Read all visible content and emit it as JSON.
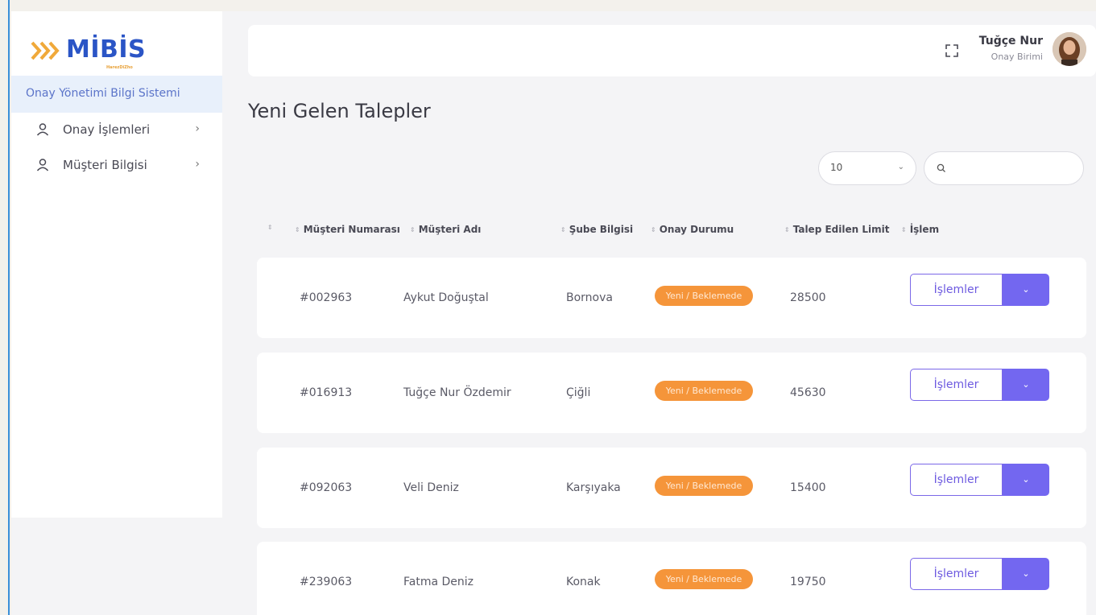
{
  "app": {
    "logo_text": "MİBİS",
    "logo_sub": "HarezDiZho",
    "system_title": "Onay Yönetimi Bilgi Sistemi"
  },
  "sidebar": {
    "items": [
      {
        "label": "Onay İşlemleri",
        "icon": "user-icon"
      },
      {
        "label": "Müşteri Bilgisi",
        "icon": "user-icon"
      }
    ]
  },
  "header": {
    "user_name": "Tuğçe Nur",
    "user_role": "Onay Birimi"
  },
  "page": {
    "title": "Yeni Gelen Talepler"
  },
  "controls": {
    "page_size": "10",
    "search_placeholder": ""
  },
  "table": {
    "columns": [
      "Müşteri Numarası",
      "Müşteri Adı",
      "Şube Bilgisi",
      "Onay Durumu",
      "Talep Edilen Limit",
      "İşlem"
    ],
    "rows": [
      {
        "number": "#002963",
        "name": "Aykut Doğuştal",
        "branch": "Bornova",
        "status": "Yeni / Beklemede",
        "limit": "28500",
        "action": "İşlemler"
      },
      {
        "number": "#016913",
        "name": "Tuğçe Nur Özdemir",
        "branch": "Çiğli",
        "status": "Yeni / Beklemede",
        "limit": "45630",
        "action": "İşlemler"
      },
      {
        "number": "#092063",
        "name": "Veli Deniz",
        "branch": "Karşıyaka",
        "status": "Yeni / Beklemede",
        "limit": "15400",
        "action": "İşlemler"
      },
      {
        "number": "#239063",
        "name": "Fatma Deniz",
        "branch": "Konak",
        "status": "Yeni / Beklemede",
        "limit": "19750",
        "action": "İşlemler"
      }
    ]
  },
  "colors": {
    "brand": "#2b55c6",
    "accent": "#7367f0",
    "status_pending": "#f5953a",
    "sidebar_active_bg": "#e8f0fb"
  }
}
